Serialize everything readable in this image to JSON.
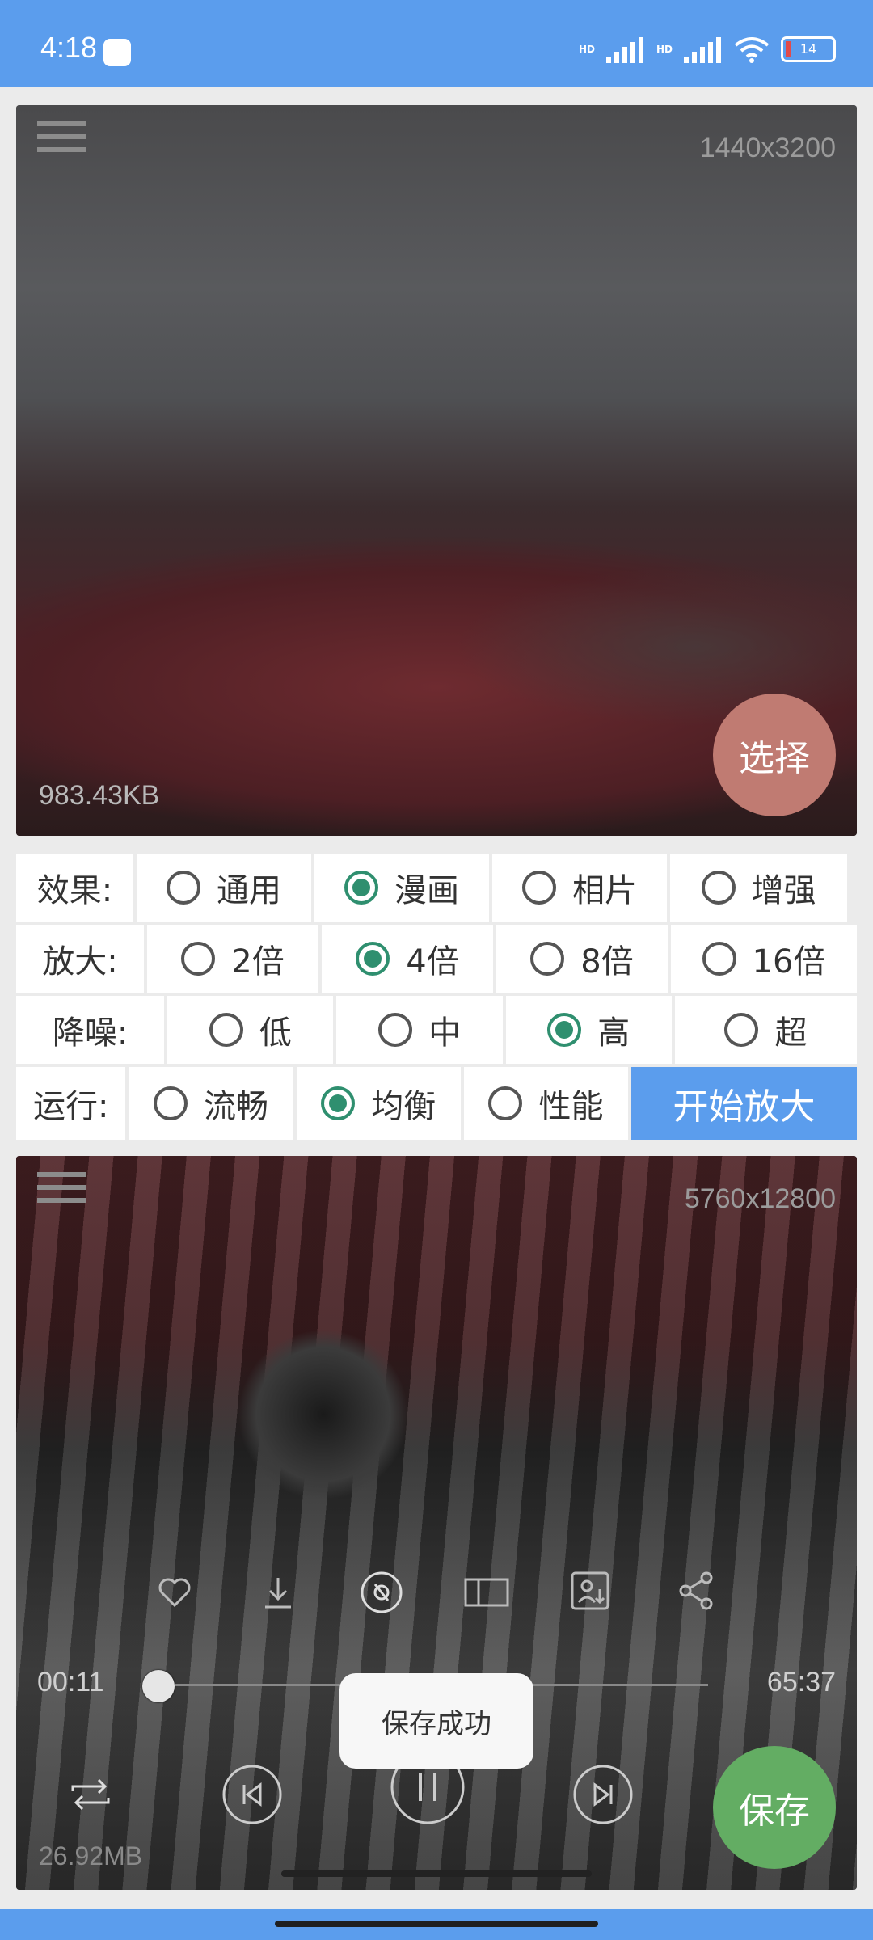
{
  "status": {
    "time": "4:18",
    "battery": "14",
    "signal1": "HD",
    "signal2": "HD"
  },
  "top_image": {
    "dimensions": "1440x3200",
    "file_size": "983.43KB",
    "select_label": "选择"
  },
  "options": {
    "effect": {
      "label": "效果:",
      "choices": [
        "通用",
        "漫画",
        "相片",
        "增强"
      ],
      "selected": "漫画"
    },
    "scale": {
      "label": "放大:",
      "choices": [
        "2倍",
        "4倍",
        "8倍",
        "16倍"
      ],
      "selected": "4倍"
    },
    "denoise": {
      "label": "降噪:",
      "choices": [
        "低",
        "中",
        "高",
        "超"
      ],
      "selected": "高"
    },
    "run": {
      "label": "运行:",
      "choices": [
        "流畅",
        "均衡",
        "性能"
      ],
      "selected": "均衡"
    },
    "start_label": "开始放大"
  },
  "bottom_image": {
    "dimensions": "5760x12800",
    "file_size": "26.92MB",
    "save_label": "保存"
  },
  "player": {
    "current_time": "00:11",
    "total_time": "65:37",
    "progress": 0.01
  },
  "toast": "保存成功",
  "icons": [
    "heart-icon",
    "download-icon",
    "disc-icon",
    "compare-icon",
    "portrait-save-icon",
    "share-icon",
    "repeat-icon",
    "previous-icon",
    "pause-icon",
    "next-icon"
  ]
}
